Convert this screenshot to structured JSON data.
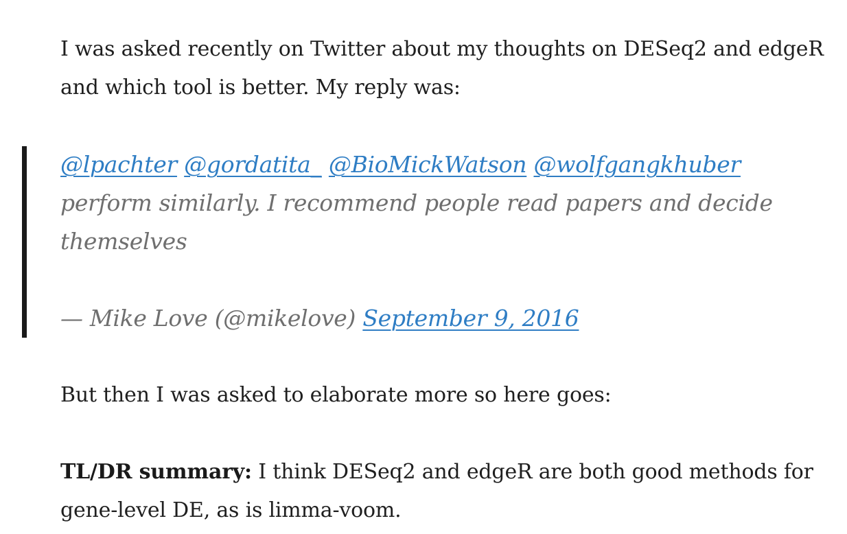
{
  "intro": {
    "text": "I was asked recently on Twitter about my thoughts on DESeq2 and edgeR and which tool is better. My reply was:"
  },
  "tweet": {
    "mentions": [
      "@lpachter",
      "@gordatita_",
      "@BioMickWatson",
      "@wolfgangkhuber"
    ],
    "text": "perform similarly. I recommend people read papers and decide themselves",
    "attribution": "— Mike Love (@mikelove)",
    "date_link": "September 9, 2016"
  },
  "elaborate": {
    "text": "But then I was asked to elaborate more so here goes:"
  },
  "tldr": {
    "label": "TL/DR summary:",
    "text": "I think DESeq2 and edgeR are both good methods for gene-level DE, as is limma-voom."
  },
  "colors": {
    "link": "#2e7dc4",
    "quote_text": "#6f6f6f",
    "body_text": "#1f1f1f",
    "quote_bar": "#1a1a1a"
  }
}
